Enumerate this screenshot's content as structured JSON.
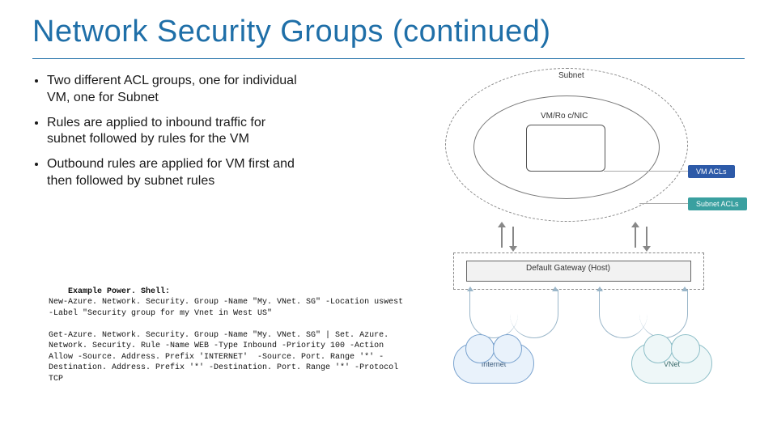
{
  "title": "Network Security Groups (continued)",
  "bullets": [
    "Two different ACL groups, one for individual VM, one for Subnet",
    "Rules are applied to inbound traffic for subnet followed by rules for the VM",
    "Outbound rules are applied for VM first and then followed by subnet rules"
  ],
  "example": {
    "label": "Example Power. Shell:",
    "block1": "New-Azure. Network. Security. Group -Name \"My. VNet. SG\" -Location uswest -Label \"Security group for my Vnet in West US\"",
    "block2": "Get-Azure. Network. Security. Group -Name \"My. VNet. SG\" | Set. Azure. Network. Security. Rule -Name WEB -Type Inbound -Priority 100 -Action Allow -Source. Address. Prefix 'INTERNET'  -Source. Port. Range '*' -Destination. Address. Prefix '*' -Destination. Port. Range '*' -Protocol TCP"
  },
  "diagram": {
    "subnet_label": "Subnet",
    "vm_label": "VM/Ro c/NIC",
    "vm_acls": "VM ACLs",
    "subnet_acls": "Subnet ACLs",
    "host_label": "Default Gateway (Host)",
    "cloud_internet": "Internet",
    "cloud_vnet": "VNet"
  }
}
